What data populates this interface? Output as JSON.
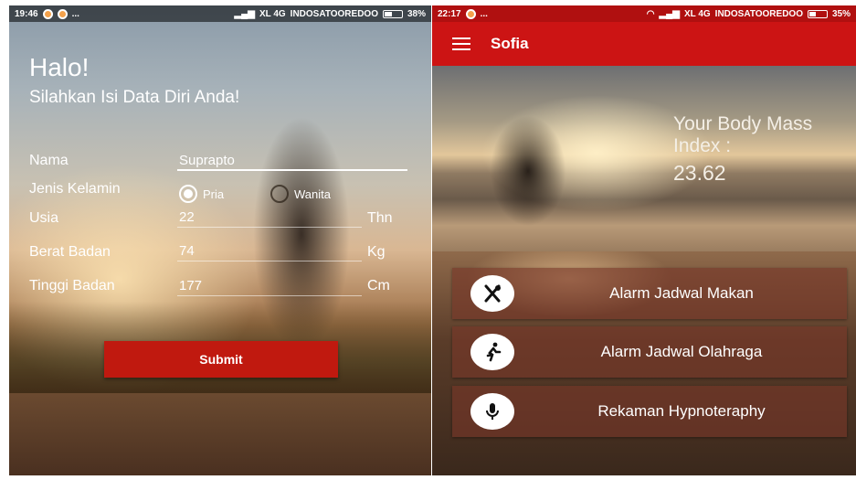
{
  "left_screen": {
    "status": {
      "time": "19:46",
      "dots": "...",
      "signal": "XL 4G",
      "carrier": "INDOSATOOREDOO",
      "battery": "38%"
    },
    "greeting": "Halo!",
    "subtitle": "Silahkan Isi Data Diri Anda!",
    "form": {
      "name_label": "Nama",
      "name_value": "Suprapto",
      "gender_label": "Jenis Kelamin",
      "gender_options": [
        "Pria",
        "Wanita"
      ],
      "gender_selected": "Pria",
      "age_label": "Usia",
      "age_value": "22",
      "age_unit": "Thn",
      "weight_label": "Berat Badan",
      "weight_value": "74",
      "weight_unit": "Kg",
      "height_label": "Tinggi Badan",
      "height_value": "177",
      "height_unit": "Cm",
      "submit_label": "Submit"
    }
  },
  "right_screen": {
    "status": {
      "time": "22:17",
      "dots": "...",
      "signal": "XL 4G",
      "carrier": "INDOSATOOREDOO",
      "battery": "35%"
    },
    "app_title": "Sofia",
    "bmi_label": "Your Body Mass Index :",
    "bmi_value": "23.62",
    "menu": [
      {
        "icon": "utensils-icon",
        "label": "Alarm Jadwal Makan"
      },
      {
        "icon": "running-person-icon",
        "label": "Alarm Jadwal Olahraga"
      },
      {
        "icon": "microphone-icon",
        "label": "Rekaman Hypnoteraphy"
      }
    ]
  },
  "colors": {
    "accent": "#cc1414",
    "submit": "#c0190f",
    "menu_overlay": "#78372899"
  }
}
